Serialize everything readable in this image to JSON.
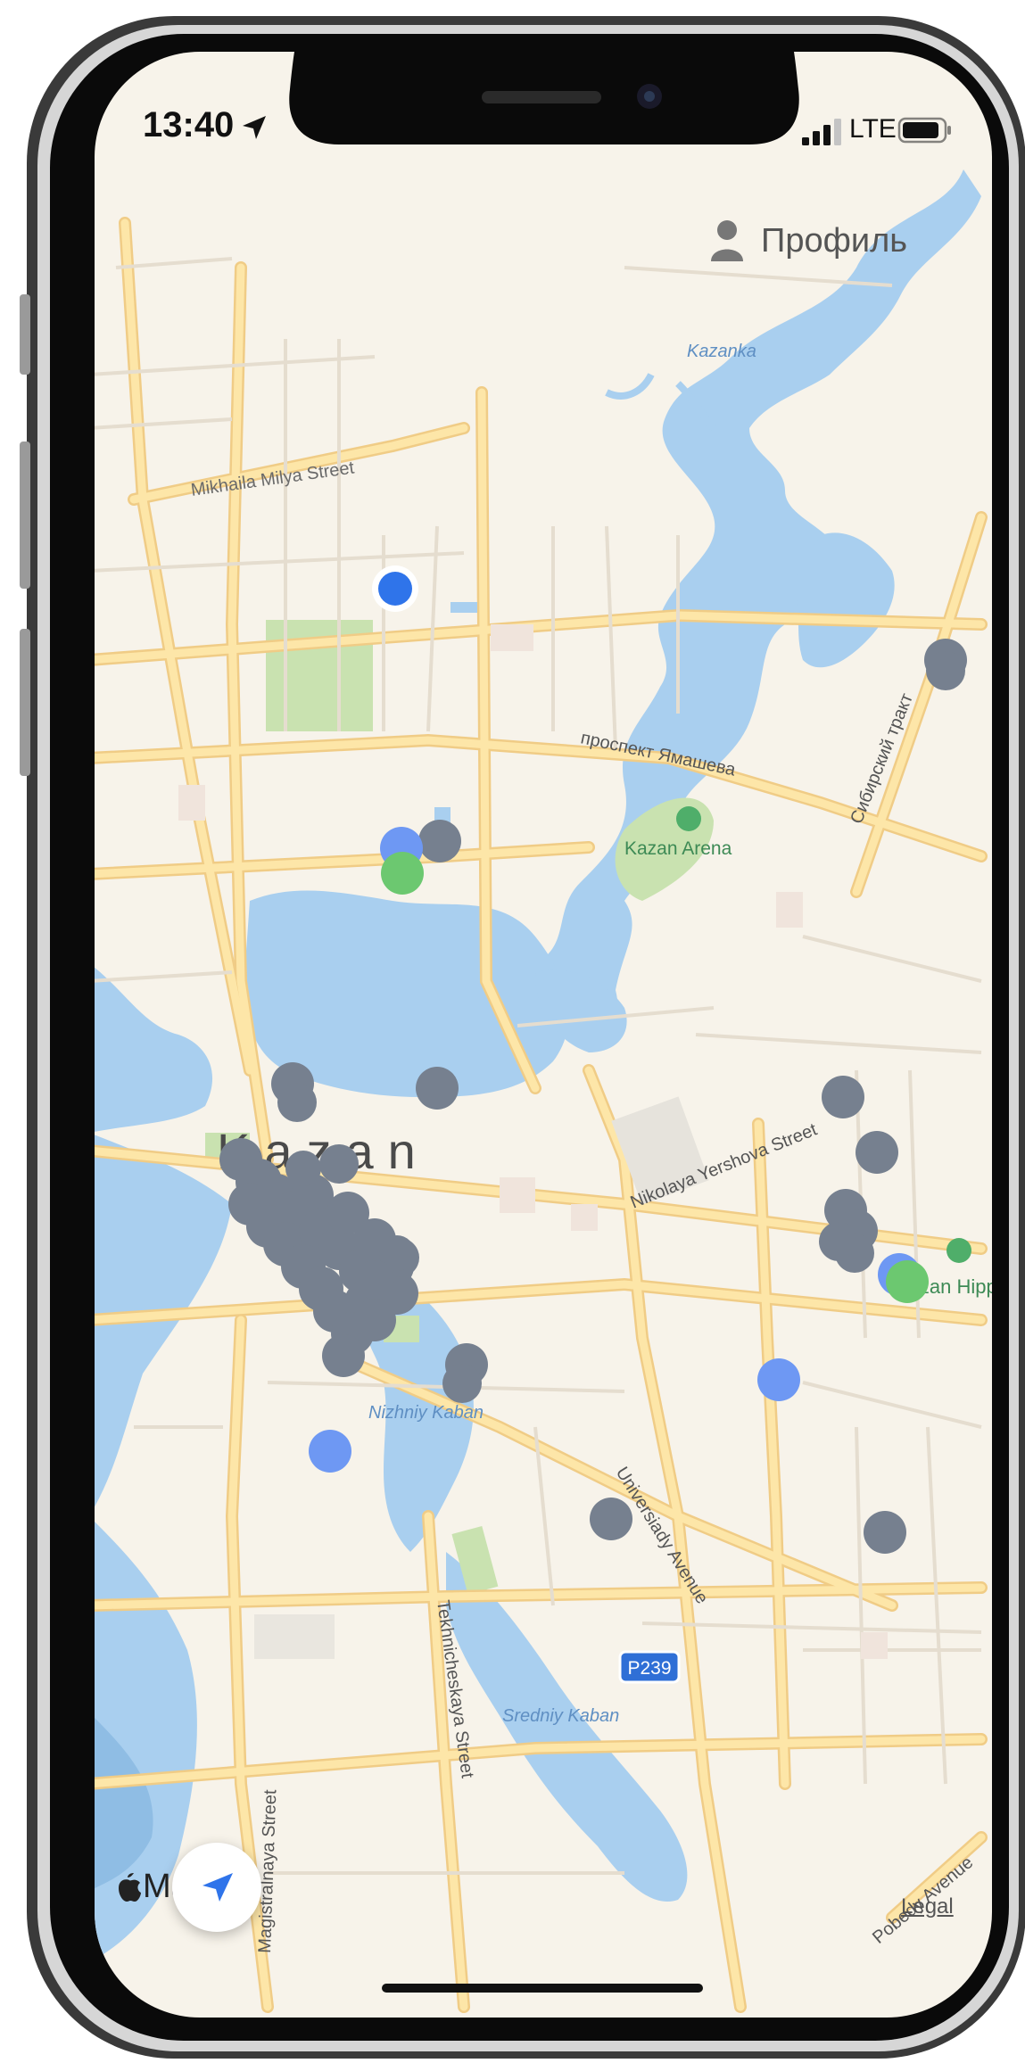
{
  "status_bar": {
    "time": "13:40",
    "network": "LTE"
  },
  "profile_button": {
    "label": "Профиль",
    "icon": "person-icon"
  },
  "map": {
    "provider_label": "Ma",
    "legal_label": "Legal",
    "city_label": "Kazan",
    "labels": {
      "kazanka": "Kazanka",
      "mikhaila_milya": "Mikhaila Milya Street",
      "yamasheva": "проспект Ямашева",
      "sibirsky": "Сибирский тракт",
      "kazan_arena": "Kazan Arena",
      "nikolaya_yershova": "Nikolaya Yershova Street",
      "kazan_hippo": "Kazan Hippo",
      "nizhniy_kaban": "Nizhniy Kaban",
      "universiady": "Universiady Avenue",
      "p239": "P239",
      "tekhnicheskaya": "Tekhnicheskaya Street",
      "sredniy_kaban": "Sredniy Kaban",
      "magistralnaya": "Magistralnaya Street",
      "pobedy": "Pobedy Avenue"
    },
    "colors": {
      "land": "#f7f3ea",
      "water": "#a9cfef",
      "park": "#c9e2b0",
      "road": "#fde6a8",
      "road_edge": "#f0cc86",
      "marker_gray": "#76808f",
      "marker_blue": "#6e98f3",
      "marker_green": "#6cc870",
      "user_location": "#2f74ea"
    }
  },
  "locate_button": {
    "icon": "location-arrow-icon"
  }
}
